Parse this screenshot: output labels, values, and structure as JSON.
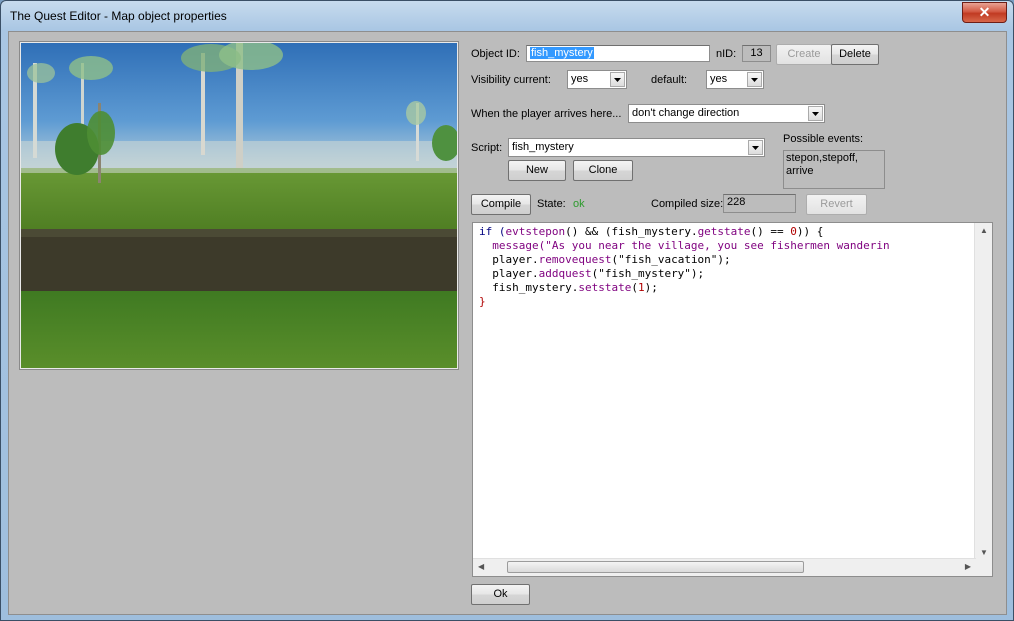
{
  "window": {
    "title": "The Quest Editor - Map object properties",
    "close_glyph": "✕"
  },
  "object": {
    "id_label": "Object ID:",
    "id_value": "fish_mystery",
    "nid_label": "nID:",
    "nid_value": "13",
    "create_label": "Create",
    "delete_label": "Delete"
  },
  "visibility": {
    "current_label": "Visibility current:",
    "current_value": "yes",
    "default_label": "default:",
    "default_value": "yes"
  },
  "arrival": {
    "label": "When the player arrives here...",
    "value": "don't change direction"
  },
  "script": {
    "label": "Script:",
    "value": "fish_mystery",
    "new_label": "New",
    "clone_label": "Clone",
    "events_label": "Possible events:",
    "events_value": "stepon,stepoff, arrive"
  },
  "compile": {
    "button_label": "Compile",
    "state_label": "State:",
    "state_value": "ok",
    "size_label": "Compiled size:",
    "size_value": "228",
    "revert_label": "Revert"
  },
  "code": {
    "line1": {
      "p1": "if (",
      "p2": "evtstepon",
      "p3": "() && (fish_mystery.",
      "p4": "getstate",
      "p5": "() == ",
      "p6": "0",
      "p7": ")) {"
    },
    "line2": {
      "p1": "  ",
      "p2": "message",
      "p3": "(\"As you near the village, you see fishermen wanderin"
    },
    "line3": {
      "p1": "  player.",
      "p2": "removequest",
      "p3": "(\"fish_vacation\");"
    },
    "line4": {
      "p1": "  player.",
      "p2": "addquest",
      "p3": "(\"fish_mystery\");"
    },
    "line5": {
      "p1": "  fish_mystery.",
      "p2": "setstate",
      "p3": "(",
      "p4": "1",
      "p5": ");"
    },
    "line6": "}"
  },
  "footer": {
    "ok_label": "Ok"
  },
  "colors": {
    "state_ok": "#2e9b2e",
    "client_bg": "#bcbcbc",
    "selection": "#3399ff"
  }
}
